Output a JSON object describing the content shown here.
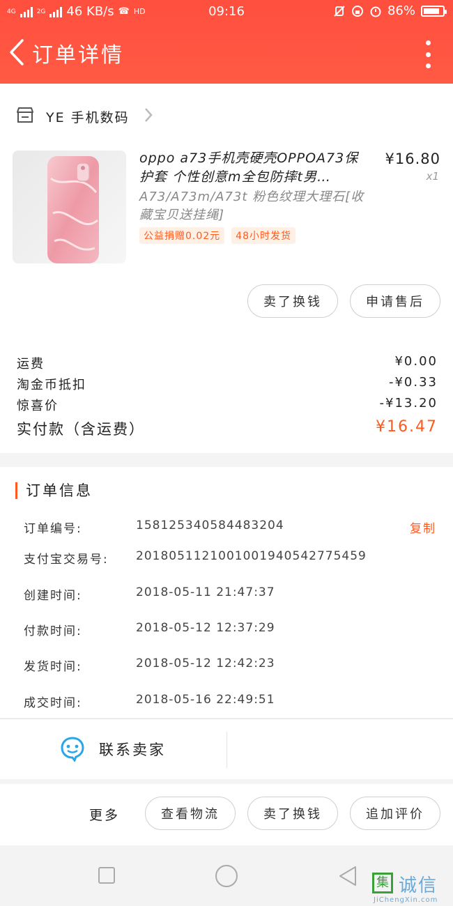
{
  "status_bar": {
    "network_left": "4G",
    "network_right": "2G",
    "speed": "46 KB/s",
    "hd": "HD",
    "time": "09:16",
    "battery": "86%",
    "battery_level": 0.86
  },
  "nav": {
    "title": "订单详情"
  },
  "shop": {
    "name": "YE 手机数码"
  },
  "product": {
    "title": "oppo a73手机壳硬壳OPPOA73保护套 个性创意m全包防摔t男…",
    "price": "¥16.80",
    "qty": "x1",
    "sku": "A73/A73m/A73t 粉色纹理大理石[收藏宝贝送挂绳]",
    "tags": [
      "公益捐赠0.02元",
      "48小时发货"
    ]
  },
  "item_actions": {
    "resell": "卖了换钱",
    "after_sale": "申请售后"
  },
  "fees": [
    {
      "label": "运费",
      "value": "¥0.00"
    },
    {
      "label": "淘金币抵扣",
      "value": "-¥0.33"
    },
    {
      "label": "惊喜价",
      "value": "-¥13.20"
    }
  ],
  "total": {
    "label": "实付款（含运费）",
    "value": "¥16.47"
  },
  "order_info": {
    "title": "订单信息",
    "copy": "复制",
    "rows": [
      {
        "label": "订单编号:",
        "value": "158125340584483204"
      },
      {
        "label": "支付宝交易号:",
        "value": "2018051121001001940542775459"
      },
      {
        "label": "创建时间:",
        "value": "2018-05-11 21:47:37"
      },
      {
        "label": "付款时间:",
        "value": "2018-05-12 12:37:29"
      },
      {
        "label": "发货时间:",
        "value": "2018-05-12 12:42:23"
      },
      {
        "label": "成交时间:",
        "value": "2018-05-16 22:49:51"
      }
    ]
  },
  "contact": {
    "label": "联系卖家"
  },
  "bottom": {
    "more": "更多",
    "logistics": "查看物流",
    "resell": "卖了换钱",
    "review": "追加评价"
  },
  "watermark": {
    "mark": "集",
    "text": "诚信",
    "sub": "JiChengXin.com"
  },
  "colors": {
    "header": "#ff5240",
    "accent": "#ff5a1e"
  }
}
